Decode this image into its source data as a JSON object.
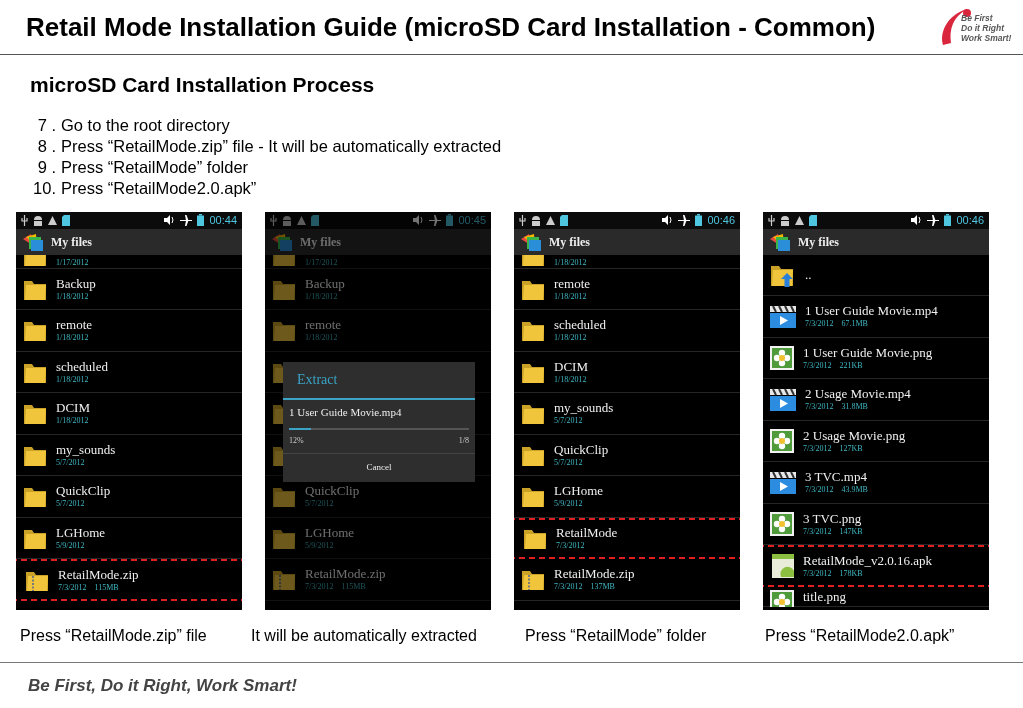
{
  "title": "Retail Mode Installation Guide (microSD Card Installation - Common)",
  "logo_text": [
    "Be First",
    "Do it Right",
    "Work Smart!"
  ],
  "section_heading": "microSD Card Installation Process",
  "steps": [
    {
      "number": "7 .",
      "text": "Go to the root directory"
    },
    {
      "number": "8 .",
      "text": "Press “RetailMode.zip” file - It will be automatically extracted"
    },
    {
      "number": "9 .",
      "text": "Press “RetailMode” folder"
    },
    {
      "number": "10.",
      "text": "Press “RetailMode2.0.apk”"
    }
  ],
  "phones": [
    {
      "time": "00:44",
      "header_title": "My files",
      "dimmed": false,
      "rows": [
        {
          "kind": "folder",
          "partial": true,
          "date": "1/17/2012",
          "highlighted": false
        },
        {
          "kind": "folder",
          "name": "Backup",
          "date": "1/18/2012",
          "highlighted": false
        },
        {
          "kind": "folder",
          "name": "remote",
          "date": "1/18/2012",
          "highlighted": false
        },
        {
          "kind": "folder",
          "name": "scheduled",
          "date": "1/18/2012",
          "highlighted": false
        },
        {
          "kind": "folder",
          "name": "DCIM",
          "date": "1/18/2012",
          "highlighted": false
        },
        {
          "kind": "folder",
          "name": "my_sounds",
          "date": "5/7/2012",
          "highlighted": false
        },
        {
          "kind": "folder",
          "name": "QuickClip",
          "date": "5/7/2012",
          "highlighted": false
        },
        {
          "kind": "folder",
          "name": "LGHome",
          "date": "5/9/2012",
          "highlighted": false
        },
        {
          "kind": "zip",
          "name": "RetailMode.zip",
          "date": "7/3/2012",
          "size": "115MB",
          "highlighted": true
        }
      ]
    },
    {
      "time": "00:45",
      "header_title": "My files",
      "dimmed": true,
      "rows": [
        {
          "kind": "folder",
          "partial": true,
          "date": "1/17/2012",
          "highlighted": false
        },
        {
          "kind": "folder",
          "name": "Backup",
          "date": "1/18/2012",
          "highlighted": false
        },
        {
          "kind": "folder",
          "name": "remote",
          "date": "1/18/2012",
          "highlighted": false
        },
        {
          "kind": "folder",
          "highlighted": false
        },
        {
          "kind": "folder",
          "highlighted": false
        },
        {
          "kind": "folder",
          "highlighted": false
        },
        {
          "kind": "folder",
          "name": "QuickClip",
          "date": "5/7/2012",
          "highlighted": false
        },
        {
          "kind": "folder",
          "name": "LGHome",
          "date": "5/9/2012",
          "highlighted": false
        },
        {
          "kind": "zip",
          "name": "RetailMode.zip",
          "date": "7/3/2012",
          "size": "115MB",
          "highlighted": false
        }
      ],
      "dialog": {
        "title": "Extract",
        "file": "1 User Guide Movie.mp4",
        "level": 0.12,
        "percent": "12%",
        "count": "1/8",
        "button": "Cancel"
      }
    },
    {
      "time": "00:46",
      "header_title": "My files",
      "dimmed": false,
      "rows": [
        {
          "kind": "folder",
          "partial": true,
          "date": "1/18/2012",
          "highlighted": false
        },
        {
          "kind": "folder",
          "name": "remote",
          "date": "1/18/2012",
          "highlighted": false
        },
        {
          "kind": "folder",
          "name": "scheduled",
          "date": "1/18/2012",
          "highlighted": false
        },
        {
          "kind": "folder",
          "name": "DCIM",
          "date": "1/18/2012",
          "highlighted": false
        },
        {
          "kind": "folder",
          "name": "my_sounds",
          "date": "5/7/2012",
          "highlighted": false
        },
        {
          "kind": "folder",
          "name": "QuickClip",
          "date": "5/7/2012",
          "highlighted": false
        },
        {
          "kind": "folder",
          "name": "LGHome",
          "date": "5/9/2012",
          "highlighted": false
        },
        {
          "kind": "folder",
          "name": "RetailMode",
          "date": "7/3/2012",
          "highlighted": true
        },
        {
          "kind": "zip",
          "name": "RetailMode.zip",
          "date": "7/3/2012",
          "size": "137MB",
          "highlighted": false
        }
      ]
    },
    {
      "time": "00:46",
      "header_title": "My files",
      "dimmed": false,
      "rows": [
        {
          "kind": "up",
          "name": "..",
          "highlighted": false
        },
        {
          "kind": "video",
          "name": "1 User Guide Movie.mp4",
          "date": "7/3/2012",
          "size": "67.1MB",
          "highlighted": false
        },
        {
          "kind": "image",
          "name": "1 User Guide Movie.png",
          "date": "7/3/2012",
          "size": "221KB",
          "highlighted": false
        },
        {
          "kind": "video",
          "name": "2 Usage Movie.mp4",
          "date": "7/3/2012",
          "size": "31.8MB",
          "highlighted": false
        },
        {
          "kind": "image",
          "name": "2 Usage Movie.png",
          "date": "7/3/2012",
          "size": "127KB",
          "highlighted": false
        },
        {
          "kind": "video",
          "name": "3 TVC.mp4",
          "date": "7/3/2012",
          "size": "43.9MB",
          "highlighted": false
        },
        {
          "kind": "image",
          "name": "3 TVC.png",
          "date": "7/3/2012",
          "size": "147KB",
          "highlighted": false
        },
        {
          "kind": "apk",
          "name": "RetailMode_v2.0.16.apk",
          "date": "7/3/2012",
          "size": "178KB",
          "highlighted": true
        },
        {
          "kind": "image",
          "name": "title.png",
          "partial": true,
          "highlighted": false
        }
      ]
    }
  ],
  "captions": [
    "Press “RetailMode.zip” file",
    "It will be automatically extracted",
    "Press “RetailMode” folder",
    "Press “RetailMode2.0.apk”"
  ],
  "footer": "Be First, Do it Right, Work Smart!"
}
